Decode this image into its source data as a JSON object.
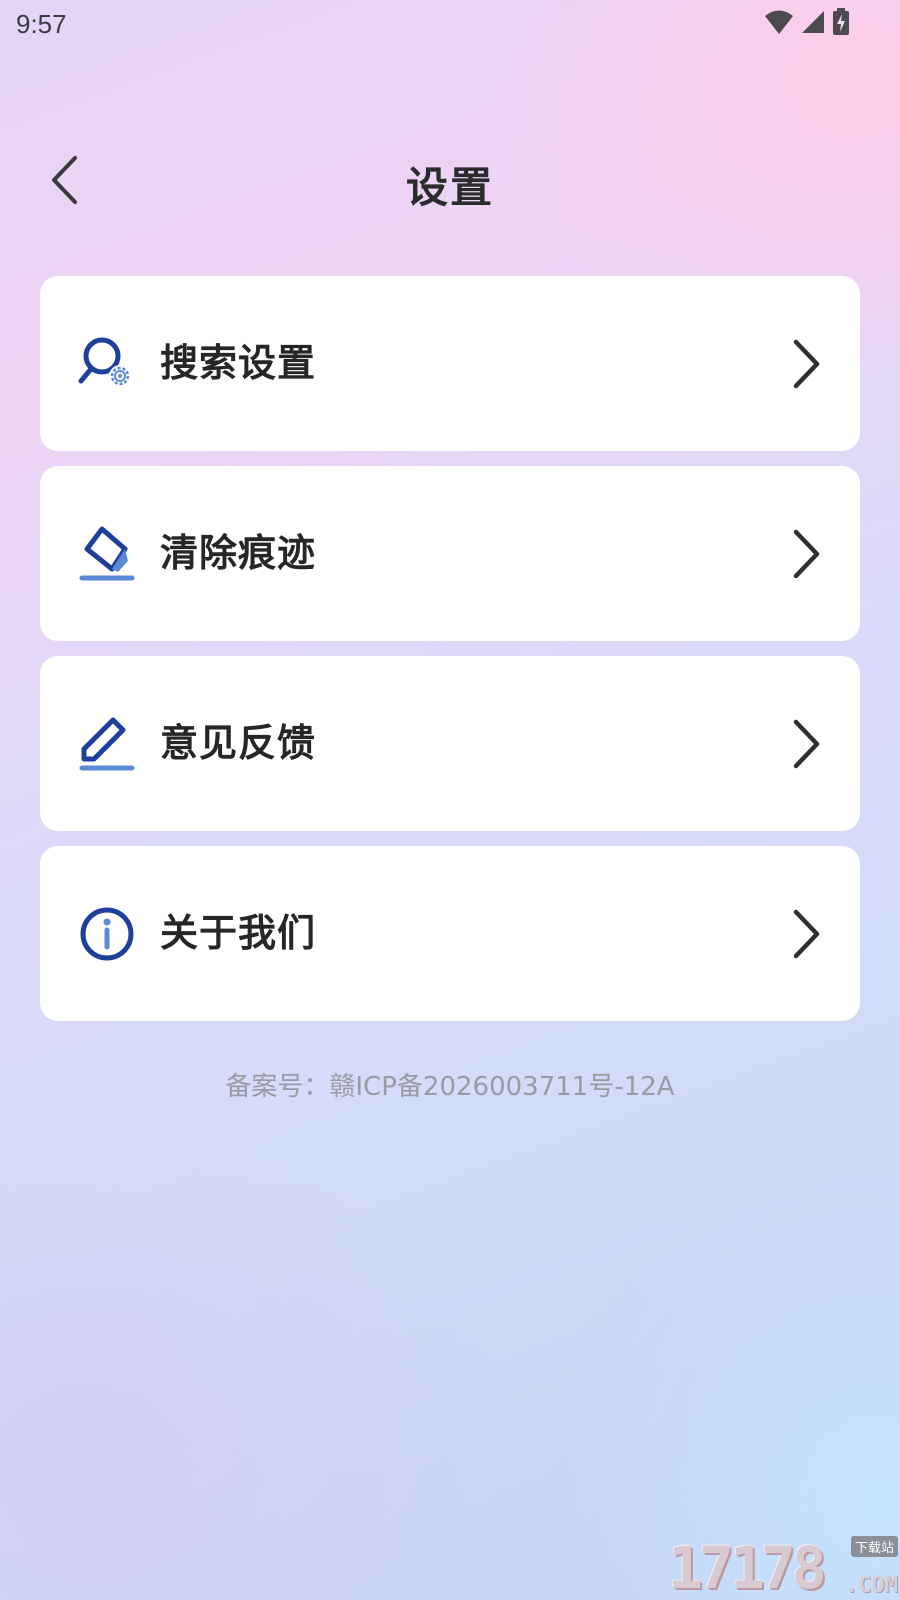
{
  "status_bar": {
    "time": "9:57",
    "icons": [
      "wifi-icon",
      "cellular-signal-icon",
      "battery-charging-icon"
    ]
  },
  "header": {
    "title": "设置",
    "back_icon": "chevron-left-icon"
  },
  "menu": {
    "items": [
      {
        "label": "搜索设置",
        "icon": "search-settings-icon"
      },
      {
        "label": "清除痕迹",
        "icon": "eraser-icon"
      },
      {
        "label": "意见反馈",
        "icon": "edit-pencil-icon"
      },
      {
        "label": "关于我们",
        "icon": "info-icon"
      }
    ]
  },
  "footer": {
    "icp": "备案号：赣ICP备2026003711号-12A"
  },
  "watermark": {
    "digits": "17178",
    "tag": "下载站",
    "suffix": ".COM"
  },
  "colors": {
    "icon_blue": "#1e3f9a",
    "icon_light_blue": "#5a8ad6",
    "text_dark": "#262629",
    "text_muted": "#9a9aa2"
  }
}
